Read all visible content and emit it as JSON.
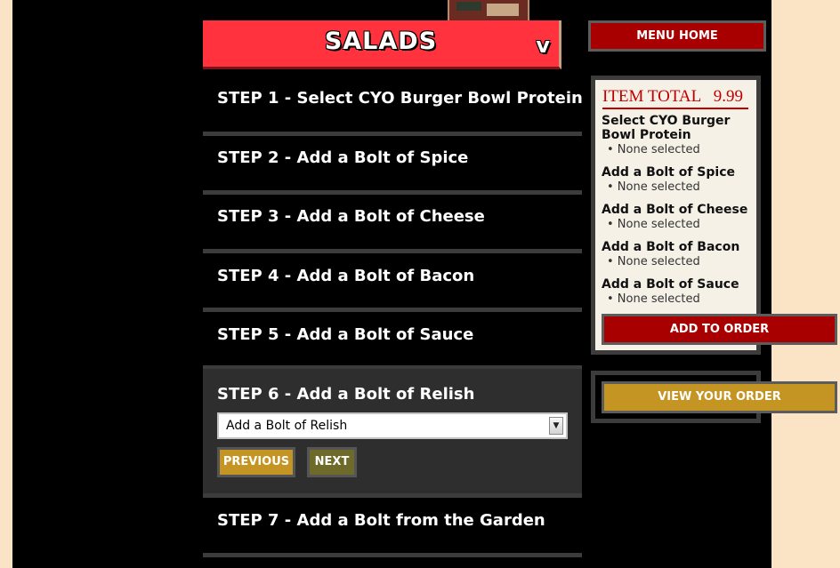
{
  "section": {
    "title": "SALADS",
    "toggle": "v"
  },
  "steps": [
    {
      "label": "STEP 1 - Select CYO Burger Bowl Protein"
    },
    {
      "label": "STEP 2 - Add a Bolt of Spice"
    },
    {
      "label": "STEP 3 - Add a Bolt of Cheese"
    },
    {
      "label": "STEP 4 - Add a Bolt of Bacon"
    },
    {
      "label": "STEP 5 - Add a Bolt of Sauce"
    },
    {
      "label": "STEP 6 - Add a Bolt of Relish"
    },
    {
      "label": "STEP 7 - Add a Bolt from the Garden"
    }
  ],
  "active_step": {
    "select_value": "Add a Bolt of Relish",
    "previous_label": "PREVIOUS",
    "next_label": "NEXT"
  },
  "sidebar": {
    "menu_home_label": "MENU HOME",
    "item_total_label": "ITEM TOTAL",
    "item_total_value": "9.99",
    "summary": [
      {
        "title": "Select CYO Burger Bowl Protein",
        "selection": "• None selected"
      },
      {
        "title": "Add a Bolt of Spice",
        "selection": "• None selected"
      },
      {
        "title": "Add a Bolt of Cheese",
        "selection": "• None selected"
      },
      {
        "title": "Add a Bolt of Bacon",
        "selection": "• None selected"
      },
      {
        "title": "Add a Bolt of Sauce",
        "selection": "• None selected"
      }
    ],
    "add_to_order_label": "ADD TO ORDER",
    "view_order_label": "VIEW YOUR ORDER"
  },
  "colors": {
    "header_red": "#ff323d",
    "button_red": "#a80000",
    "button_gold": "#c59523",
    "button_olive": "#6e6a2a",
    "page_bg": "#fbe4c6"
  }
}
